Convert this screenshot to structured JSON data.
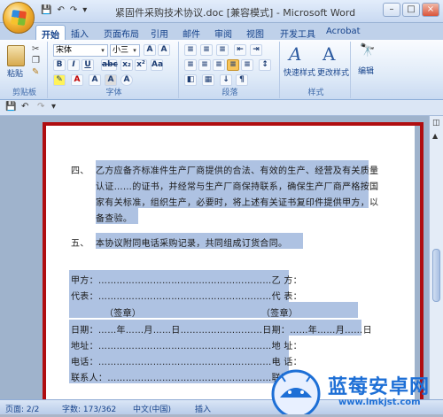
{
  "window": {
    "title": "紧固件采购技术协议.doc [兼容模式] - Microsoft Word",
    "controls": [
      "–",
      "□",
      "×"
    ]
  },
  "qat": [
    "💾",
    "↶",
    "↷",
    "▾"
  ],
  "tabs": [
    {
      "label": "开始",
      "active": true
    },
    {
      "label": "插入"
    },
    {
      "label": "页面布局"
    },
    {
      "label": "引用"
    },
    {
      "label": "邮件"
    },
    {
      "label": "审阅"
    },
    {
      "label": "视图"
    },
    {
      "label": "开发工具"
    },
    {
      "label": "Acrobat"
    }
  ],
  "ribbon": {
    "clipboard": {
      "paste": "粘贴",
      "label": "剪贴板"
    },
    "font": {
      "name": "宋体",
      "size": "小三",
      "label": "字体"
    },
    "paragraph": {
      "label": "段落"
    },
    "styles": {
      "quick": "快速样式",
      "change": "更改样式",
      "label": "样式"
    },
    "edit": {
      "label": "编辑"
    }
  },
  "doc": {
    "item4_num": "四、",
    "item4_l1": "乙方应备齐标准件生产厂商提供的合法、有效的生产、经营及有关质量",
    "item4_l2": "认证……的证书，并经常与生产厂商保持联系，确保生产厂商严格按国",
    "item4_l3": "家有关标准，组织生产，必要时，将上述有关证书复印件提供甲方，以",
    "item4_l4": "备查验。",
    "item5_num": "五、",
    "item5_text": "本协议附同电话采购记录，共同组成订货合同。",
    "sig_a1": "甲方：…………………………………………………乙  方：",
    "sig_a2": "代表：…………………………………………………代  表：",
    "sig_a3": "（签章）                                       （签章）",
    "sig_a4": "日期：……年……月……日………………………日期：……年……月……日",
    "sig_a5": "地址：…………………………………………………地    址：",
    "sig_a6": "电话：…………………………………………………电    话：",
    "sig_a7": "联系人：………………………………………………联系人："
  },
  "status": {
    "page": "页面: 2/2",
    "words": "字数: 173/362",
    "lang": "中文(中国)",
    "mode": "插入"
  },
  "watermark": {
    "title": "蓝莓安卓网",
    "url": "www.lmkjst.com"
  },
  "colors": {
    "highlight": "#aec2e2",
    "redbox": "#b00d10",
    "watermark": "#1d6fd6"
  }
}
